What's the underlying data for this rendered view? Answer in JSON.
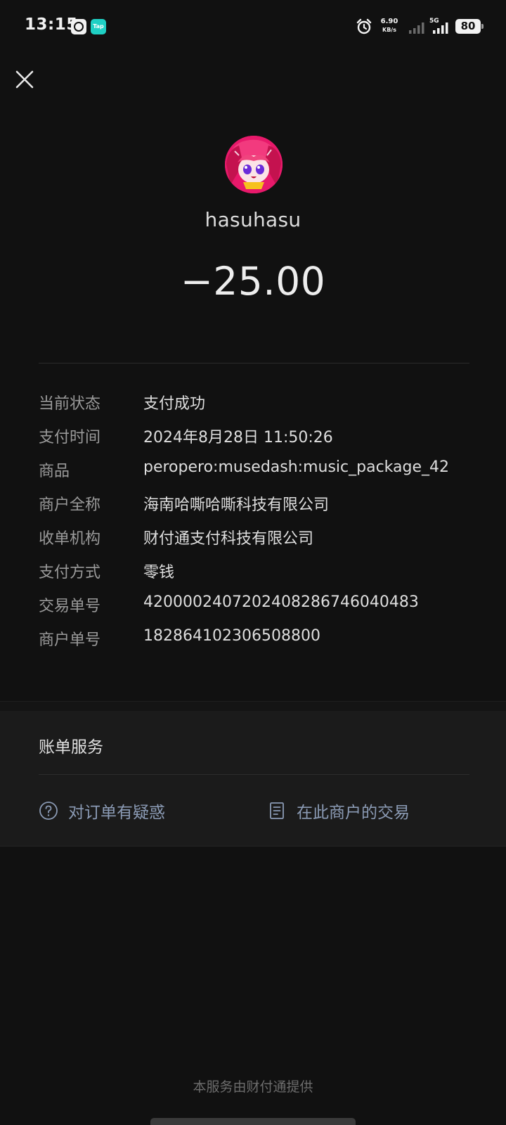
{
  "status_bar": {
    "time": "13:15",
    "app_icon_2": "Tap",
    "net_speed_value": "6.90",
    "net_speed_unit": "KB/s",
    "network_type": "5G",
    "battery": "80"
  },
  "header": {
    "merchant_name": "hasuhasu",
    "amount": "−25.00"
  },
  "details": [
    {
      "label": "当前状态",
      "value": "支付成功"
    },
    {
      "label": "支付时间",
      "value": "2024年8月28日 11:50:26"
    },
    {
      "label": "商品",
      "value": "peropero:musedash:music_package_42"
    },
    {
      "label": "商户全称",
      "value": "海南哈嘶哈嘶科技有限公司"
    },
    {
      "label": "收单机构",
      "value": "财付通支付科技有限公司"
    },
    {
      "label": "支付方式",
      "value": "零钱"
    },
    {
      "label": "交易单号",
      "value": "4200002407202408286746040483"
    },
    {
      "label": "商户单号",
      "value": "182864102306508800"
    }
  ],
  "bill_services": {
    "title": "账单服务",
    "links": [
      {
        "label": "对订单有疑惑",
        "icon": "question-circle-icon"
      },
      {
        "label": "在此商户的交易",
        "icon": "document-icon"
      }
    ]
  },
  "footer": "本服务由财付通提供",
  "colors": {
    "background": "#111111",
    "card": "#1b1b1b",
    "link": "#8b9bb5",
    "avatar_accent": "#e8196b"
  }
}
